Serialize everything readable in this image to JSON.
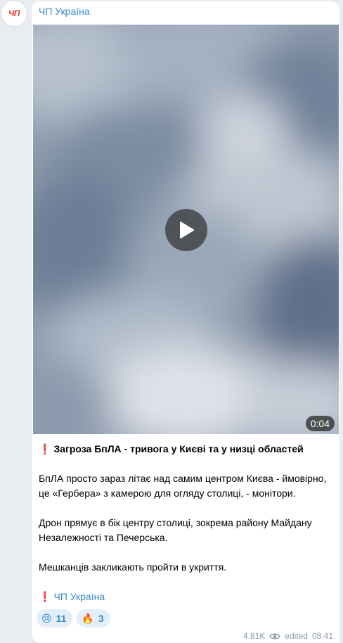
{
  "channel": {
    "name": "ЧП Україна",
    "avatar_text": "ЧП"
  },
  "media": {
    "type": "video",
    "duration": "0:04",
    "play_icon": "play-icon"
  },
  "post": {
    "headline_mark": "❗",
    "headline": "Загроза БпЛА - тривога у Києві та у низці областей",
    "paragraphs": [
      "БпЛА просто зараз літає над самим центром Києва - ймовірно, це «Гербера» з камерою для огляду столиці, - монітори.",
      "Дрон прямує в бік центру столиці, зокрема району Майдану Незалежності та Печерська.",
      "Мешканців закликають пройти в укриття."
    ],
    "signature_mark": "❗",
    "signature": "ЧП Україна"
  },
  "reactions": [
    {
      "emoji": "😢",
      "count": "11"
    },
    {
      "emoji": "🔥",
      "count": "3"
    }
  ],
  "footer": {
    "views": "4.81K",
    "views_icon": "eye-icon",
    "edited": "edited",
    "time": "08:41"
  },
  "colors": {
    "accent": "#3a89c9",
    "alert": "#e0245e",
    "background": "#e9edf1"
  }
}
